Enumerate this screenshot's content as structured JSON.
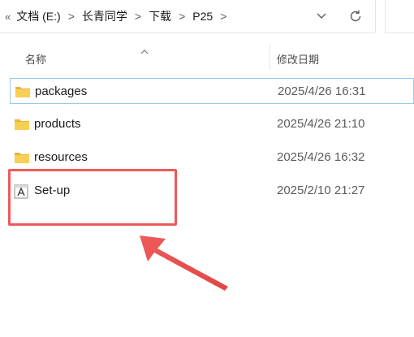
{
  "address_bar": {
    "overflow": "«",
    "crumbs": [
      "文档 (E:)",
      "长青同学",
      "下载",
      "P25"
    ],
    "separator": ">"
  },
  "columns": {
    "name": "名称",
    "date_modified": "修改日期"
  },
  "files": [
    {
      "name": "packages",
      "date": "2025/4/26 16:31",
      "type": "folder-icon"
    },
    {
      "name": "products",
      "date": "2025/4/26 21:10",
      "type": "folder-icon"
    },
    {
      "name": "resources",
      "date": "2025/4/26 16:32",
      "type": "folder-icon"
    },
    {
      "name": "Set-up",
      "date": "2025/2/10 21:27",
      "type": "setup-app-icon"
    }
  ],
  "annotation": {
    "color": "#ee5a5a"
  }
}
